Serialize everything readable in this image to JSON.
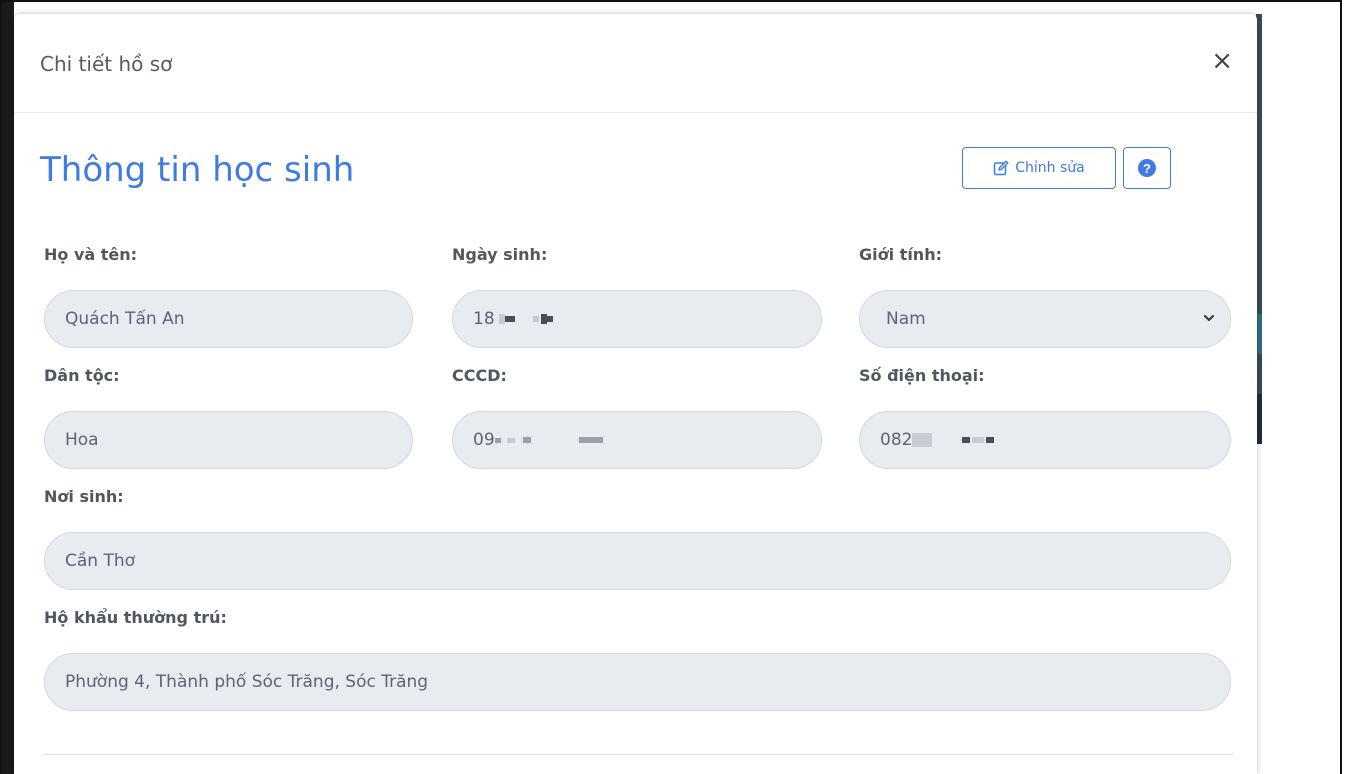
{
  "modal": {
    "title": "Chi tiết hồ sơ",
    "close_label": "×"
  },
  "section": {
    "title": "Thông tin học sinh",
    "edit_label": "Chỉnh sửa",
    "help_label": "?"
  },
  "fields": {
    "full_name": {
      "label": "Họ và tên:",
      "value": "Quách Tấn An"
    },
    "birth_date": {
      "label": "Ngày sinh:",
      "value": "18"
    },
    "gender": {
      "label": "Giới tính:",
      "value": "Nam"
    },
    "ethnicity": {
      "label": "Dân tộc:",
      "value": "Hoa"
    },
    "id_number": {
      "label": "CCCD:",
      "value": "09"
    },
    "phone": {
      "label": "Số điện thoại:",
      "value": "082"
    },
    "birth_place": {
      "label": "Nơi sinh:",
      "value": "Cần Thơ"
    },
    "residence": {
      "label": "Hộ khẩu thường trú:",
      "value": "Phường 4, Thành phố Sóc Trăng, Sóc Trăng"
    }
  },
  "colors": {
    "accent": "#3f7be0",
    "field_bg": "#e8ebf0",
    "label_text": "#50575f"
  },
  "icons": {
    "edit": "edit-icon",
    "help": "question-circle-icon",
    "close": "close-icon",
    "select": "chevron-down-icon"
  }
}
